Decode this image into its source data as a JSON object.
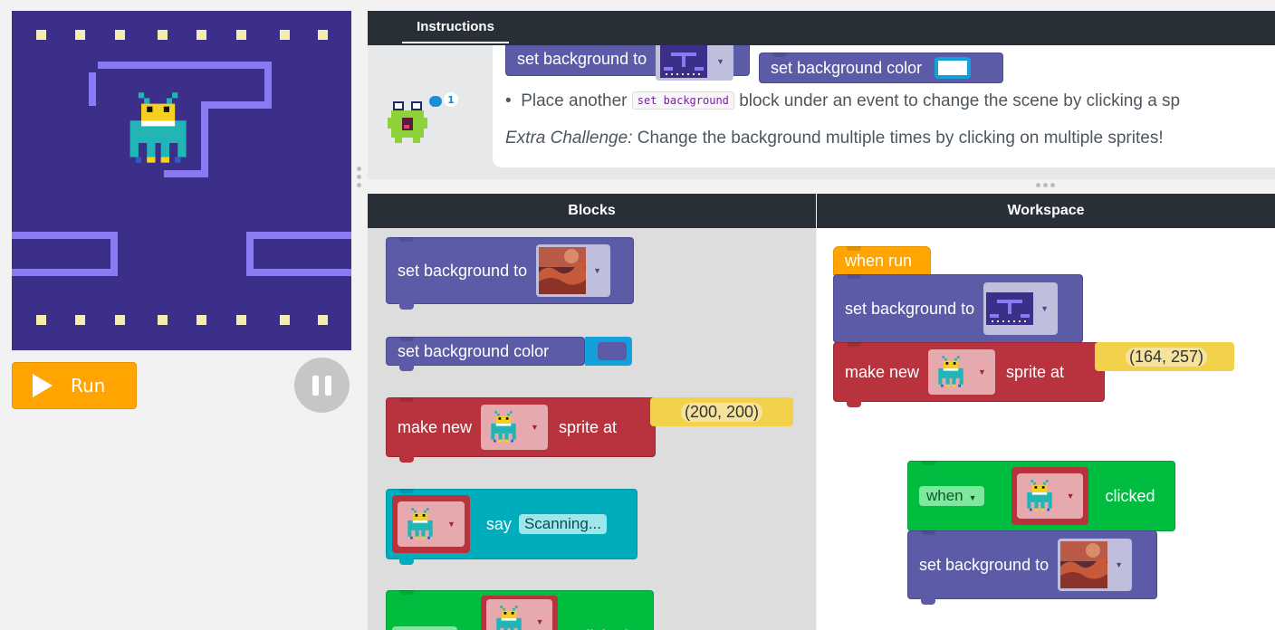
{
  "run": {
    "label": "Run"
  },
  "instructions": {
    "tab_label": "Instructions",
    "badge_count": "1",
    "visible_blocks": [
      "set background to",
      "set background color"
    ],
    "bullet_prefix": "Place another",
    "bullet_code": "set background",
    "bullet_suffix": "block under an event to change the scene by clicking a sp",
    "extra_label": "Extra Challenge:",
    "extra_text": "Change the background multiple times by clicking on multiple sprites!"
  },
  "panels": {
    "blocks_title": "Blocks",
    "workspace_title": "Workspace"
  },
  "toolbox": {
    "set_bg_label": "set background to",
    "set_bg_color_label": "set background color",
    "make_new_label": "make new",
    "sprite_at_label": "sprite at",
    "coord": "(200, 200)",
    "say_label": "say",
    "say_text": "Scanning...",
    "when_label": "when",
    "clicked_label": "clicked"
  },
  "workspace": {
    "when_run_label": "when run",
    "set_bg_label": "set background to",
    "make_new_label": "make new",
    "sprite_at_label": "sprite at",
    "coord": "(164, 257)",
    "when_label": "when",
    "clicked_label": "clicked",
    "set_bg2_label": "set background to"
  },
  "colors": {
    "purple_block": "#5b5ba8",
    "red_block": "#b8333e",
    "teal_block": "#00adbc",
    "green_block": "#00bd3f",
    "orange_block": "#ffa400",
    "stage_bg": "#3c2f8a",
    "header_bg": "#292f36",
    "run_button": "#ffa400"
  },
  "icons": [
    "play-icon",
    "pause-icon",
    "alien-sprite-icon",
    "helper-character-icon",
    "maze-background-thumb",
    "mars-background-thumb"
  ]
}
